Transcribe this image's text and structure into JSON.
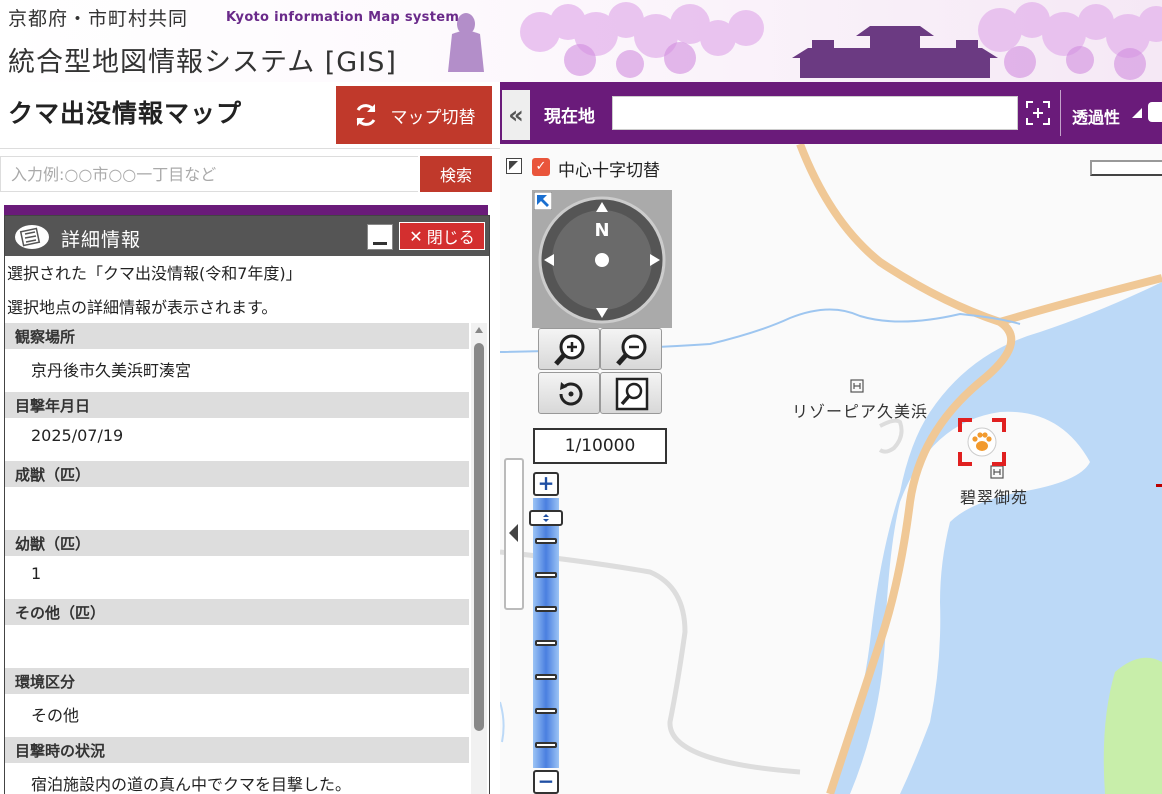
{
  "banner": {
    "line1": "京都府・市町村共同",
    "en": "Kyoto information Map system",
    "line2": "統合型地図情報システム [GIS]"
  },
  "left": {
    "title": "クマ出没情報マップ",
    "switch_label": "マップ切替",
    "search_placeholder": "入力例:○○市○○一丁目など",
    "search_button": "検索"
  },
  "detail": {
    "title": "詳細情報",
    "close_label": "閉じる",
    "desc1": "選択された「クマ出没情報(令和7年度)」",
    "desc2": "選択地点の詳細情報が表示されます。",
    "fields": [
      {
        "label": "観察場所",
        "value": "京丹後市久美浜町湊宮"
      },
      {
        "label": "目撃年月日",
        "value": "2025/07/19"
      },
      {
        "label": "成獣（匹）",
        "value": ""
      },
      {
        "label": "幼獣（匹）",
        "value": "1"
      },
      {
        "label": "その他（匹）",
        "value": ""
      },
      {
        "label": "環境区分",
        "value": "その他"
      },
      {
        "label": "目撃時の状況",
        "value": "宿泊施設内の道の真ん中でクマを目撃した。"
      }
    ]
  },
  "map": {
    "toolbar": {
      "collapse": "«",
      "location_label": "現在地",
      "location_value": "",
      "opacity_label": "透過性"
    },
    "crosshair_label": "中心十字切替",
    "compass_north": "N",
    "scale": "1/10000",
    "zoom_plus": "+",
    "zoom_minus": "−",
    "poi1": "リゾーピア久美浜",
    "poi2": "碧翠御苑"
  },
  "colors": {
    "toolbar": "#6a1b7a",
    "accent_red": "#c0392b",
    "water": "#bcd9f7",
    "road": "#f0c896",
    "green": "#c8eeaa"
  }
}
